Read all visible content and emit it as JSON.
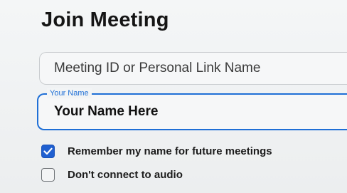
{
  "title": "Join Meeting",
  "meeting_id_field": {
    "value": "",
    "placeholder": "Meeting ID or Personal Link Name"
  },
  "name_field": {
    "label": "Your Name",
    "value": "Your Name Here"
  },
  "options": [
    {
      "label": "Remember my name for future meetings",
      "checked": true
    },
    {
      "label": "Don't connect to audio",
      "checked": false
    }
  ],
  "colors": {
    "accent": "#1f6fd6",
    "checkbox_checked": "#1f5fd0",
    "background": "#eef0f1"
  },
  "icons": {
    "checked": "checkmark-icon"
  }
}
